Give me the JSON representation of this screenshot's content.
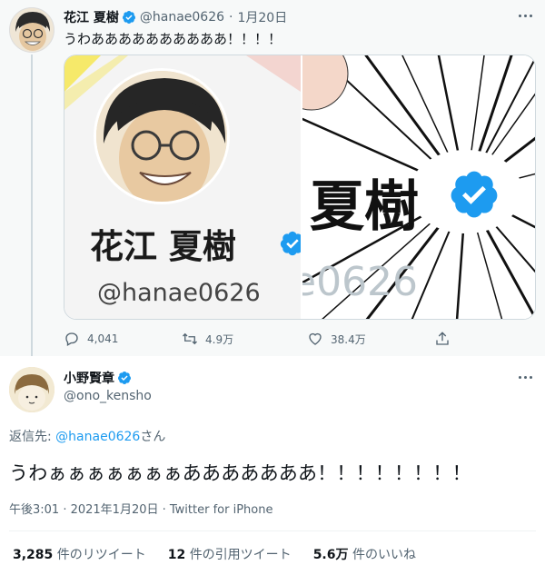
{
  "tweet1": {
    "author_name": "花江 夏樹",
    "handle": "@hanae0626",
    "separator": "·",
    "date": "1月20日",
    "text": "うわああああああああああ！！！！",
    "media": {
      "profile_name": "花江 夏樹",
      "profile_handle": "@hanae0626",
      "manga_name": "夏樹",
      "manga_handle": "e0626"
    },
    "actions": {
      "replies": "4,041",
      "retweets": "4.9万",
      "likes": "38.4万"
    }
  },
  "tweet2": {
    "author_name": "小野賢章",
    "handle": "@ono_kensho",
    "reply_prefix": "返信先: ",
    "reply_target": "@hanae0626",
    "reply_suffix": "さん",
    "text": "うわぁぁぁぁぁぁぁあああああああ！！！！！！！！",
    "meta": "午後3:01 · 2021年1月20日 · Twitter for iPhone",
    "stats": {
      "retweets_count": "3,285",
      "retweets_label": "件のリツイート",
      "quotes_count": "12",
      "quotes_label": "件の引用ツイート",
      "likes_count": "5.6万",
      "likes_label": "件のいいね"
    }
  },
  "colors": {
    "accent": "#1d9bf0",
    "verified": "#1d9bf0",
    "secondary_text": "#536471",
    "tweet1_background": "#f7f9f9"
  },
  "icons": [
    "verified-badge-icon",
    "more-icon",
    "reply-icon",
    "retweet-icon",
    "like-icon",
    "share-icon"
  ]
}
